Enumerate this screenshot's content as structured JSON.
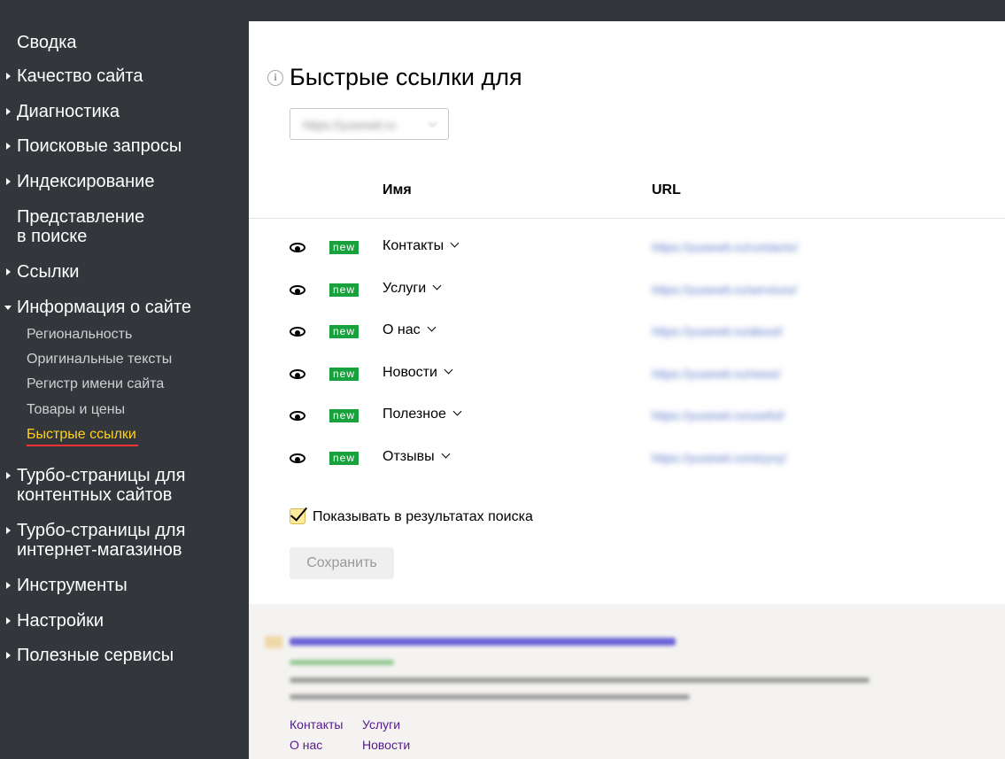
{
  "sidebar": {
    "items": [
      {
        "label": "Сводка",
        "caret": ""
      },
      {
        "label": "Качество сайта",
        "caret": "right"
      },
      {
        "label": "Диагностика",
        "caret": "right"
      },
      {
        "label": "Поисковые запросы",
        "caret": "right"
      },
      {
        "label": "Индексирование",
        "caret": "right"
      },
      {
        "label": "Представление\nв поиске",
        "caret": ""
      },
      {
        "label": "Ссылки",
        "caret": "right"
      },
      {
        "label": "Информация о сайте",
        "caret": "down"
      },
      {
        "label": "Турбо-страницы для\nконтентных сайтов",
        "caret": "right"
      },
      {
        "label": "Турбо-страницы для\nинтернет-магазинов",
        "caret": "right"
      },
      {
        "label": "Инструменты",
        "caret": "right"
      },
      {
        "label": "Настройки",
        "caret": "right"
      },
      {
        "label": "Полезные сервисы",
        "caret": "right"
      }
    ],
    "sub_items": [
      {
        "label": "Региональность"
      },
      {
        "label": "Оригинальные тексты"
      },
      {
        "label": "Регистр имени сайта"
      },
      {
        "label": "Товары и цены"
      },
      {
        "label": "Быстрые ссылки",
        "active": true
      }
    ]
  },
  "main": {
    "title": "Быстрые ссылки для",
    "info_icon_glyph": "i",
    "site_select_value": "https://yusewit.ru",
    "columns": {
      "name": "Имя",
      "url": "URL"
    },
    "badge_label": "new",
    "rows": [
      {
        "name": "Контакты",
        "url": "https://yusewit.ru/contacts/"
      },
      {
        "name": "Услуги",
        "url": "https://yusewit.ru/services/"
      },
      {
        "name": "О нас",
        "url": "https://yusewit.ru/about/"
      },
      {
        "name": "Новости",
        "url": "https://yusewit.ru/news/"
      },
      {
        "name": "Полезное",
        "url": "https://yusewit.ru/useful/"
      },
      {
        "name": "Отзывы",
        "url": "https://yusewit.ru/otzyvy/"
      }
    ],
    "show_in_results_label": "Показывать в результатах поиска",
    "show_in_results_checked": true,
    "save_label": "Сохранить"
  },
  "preview": {
    "links": [
      "Контакты",
      "Услуги",
      "О нас",
      "Новости"
    ]
  },
  "colors": {
    "sidebar_bg": "#33363b",
    "active_item": "#ffd21e",
    "active_underline": "#ff3333",
    "badge_green": "#19a13e",
    "preview_bg": "#f4f3f1",
    "preview_link": "#551a8b"
  }
}
